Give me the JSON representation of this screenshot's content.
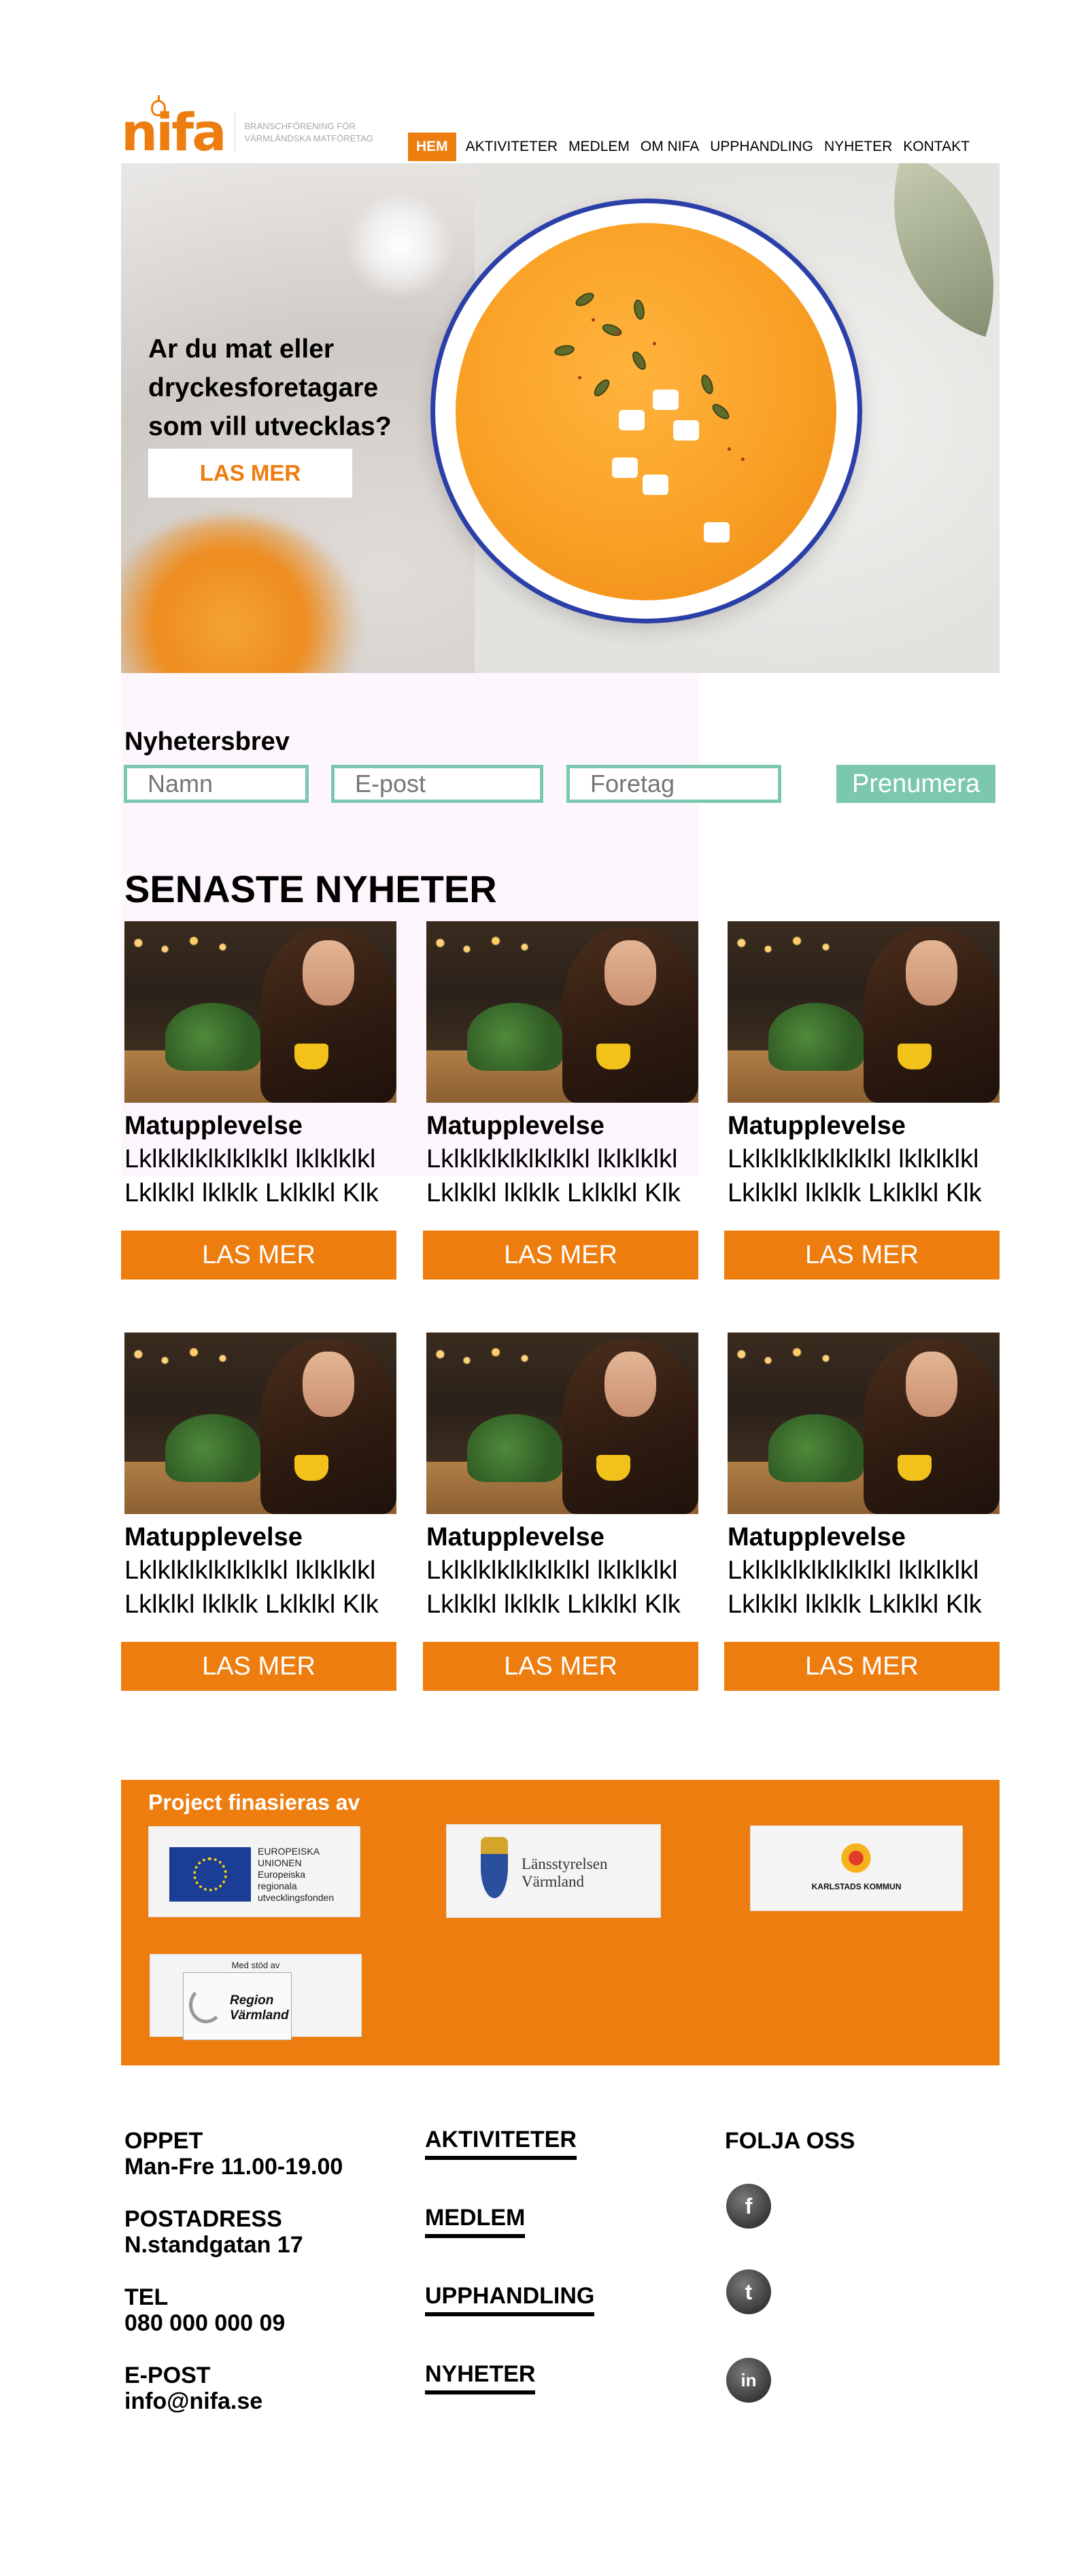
{
  "header": {
    "logo_word": "nifa",
    "tagline_line1": "BRANSCHFÖRENING FÖR",
    "tagline_line2": "VÄRMLÄNDSKA MATFÖRETAG",
    "nav": [
      "HEM",
      "AKTIVITETER",
      "MEDLEM",
      "OM NIFA",
      "UPPHANDLING",
      "NYHETER",
      "KONTAKT"
    ]
  },
  "hero": {
    "line1": "Ar du mat eller",
    "line2": "dryckesforetagare",
    "line3": "som vill utvecklas?",
    "button": "LAS MER"
  },
  "newsletter": {
    "title": "Nyhetersbrev",
    "name_placeholder": "Namn",
    "email_placeholder": "E-post",
    "company_placeholder": "Foretag",
    "submit": "Prenumera"
  },
  "news": {
    "title": "SENASTE NYHETER",
    "cards": [
      {
        "name": "Matupplevelse",
        "line1": "Lklklklklklklklkl lklklklkl",
        "line2": "Lklklkl lklklk Lklklkl Klk",
        "button": "LAS MER"
      },
      {
        "name": "Matupplevelse",
        "line1": "Lklklklklklklklkl lklklklkl",
        "line2": "Lklklkl lklklk Lklklkl Klk",
        "button": "LAS MER"
      },
      {
        "name": "Matupplevelse",
        "line1": "Lklklklklklklklkl lklklklkl",
        "line2": "Lklklkl lklklk Lklklkl Klk",
        "button": "LAS MER"
      },
      {
        "name": "Matupplevelse",
        "line1": "Lklklklklklklklkl lklklklkl",
        "line2": "Lklklkl lklklk Lklklkl Klk",
        "button": "LAS MER"
      },
      {
        "name": "Matupplevelse",
        "line1": "Lklklklklklklklkl lklklklkl",
        "line2": "Lklklkl lklklk Lklklkl Klk",
        "button": "LAS MER"
      },
      {
        "name": "Matupplevelse",
        "line1": "Lklklklklklklklkl lklklklkl",
        "line2": "Lklklkl lklklk Lklklkl Klk",
        "button": "LAS MER"
      }
    ]
  },
  "funding": {
    "title": "Project finasieras av",
    "eu": {
      "l1": "EUROPEISKA",
      "l2": "UNIONEN",
      "l3": "Europeiska",
      "l4": "regionala",
      "l5": "utvecklingsfonden"
    },
    "lst": {
      "l1": "Länsstyrelsen",
      "l2": "Värmland"
    },
    "kk": "KARLSTADS KOMMUN",
    "region": {
      "top": "Med stöd av",
      "l1": "Region",
      "l2": "Värmland"
    }
  },
  "footer": {
    "open_label": "OPPET",
    "open_value": "Man-Fre  11.00-19.00",
    "address_label": "POSTADRESS",
    "address_value": "N.standgatan 17",
    "tel_label": "TEL",
    "tel_value": "080 000 000 09",
    "email_label": "E-POST",
    "email_value": "info@nifa.se",
    "links": [
      "AKTIVITETER",
      "MEDLEM",
      "UPPHANDLING",
      "NYHETER"
    ],
    "follow": "FOLJA OSS",
    "social": [
      {
        "icon": "facebook-icon",
        "glyph": "f"
      },
      {
        "icon": "twitter-icon",
        "glyph": "t"
      },
      {
        "icon": "linkedin-icon",
        "glyph": "in"
      }
    ]
  },
  "colors": {
    "accent": "#ee7d0f",
    "teal": "#7cc8ae"
  }
}
